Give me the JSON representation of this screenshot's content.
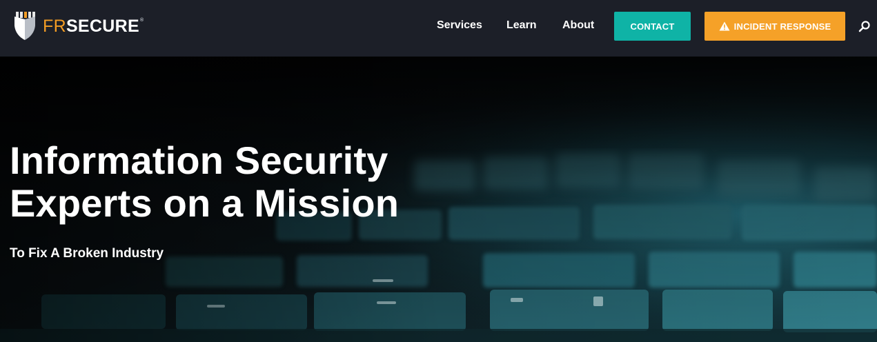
{
  "header": {
    "logo": {
      "prefix": "FR",
      "name": "SECURE",
      "trademark": "®"
    },
    "nav": [
      {
        "label": "Services"
      },
      {
        "label": "Learn"
      },
      {
        "label": "About"
      }
    ],
    "contact_label": "CONTACT",
    "incident_label": "INCIDENT RESPONSE",
    "icons": {
      "search": "search-icon",
      "warning": "warning-icon",
      "logo": "shield-icon"
    }
  },
  "hero": {
    "title_line1": "Information Security",
    "title_line2": "Experts on a Mission",
    "subtitle": "To Fix A Broken Industry"
  },
  "colors": {
    "header_bg": "#1c1f28",
    "accent_teal": "#0fb3a6",
    "accent_orange": "#f5a128",
    "logo_orange": "#f39c24",
    "text_white": "#ffffff"
  }
}
